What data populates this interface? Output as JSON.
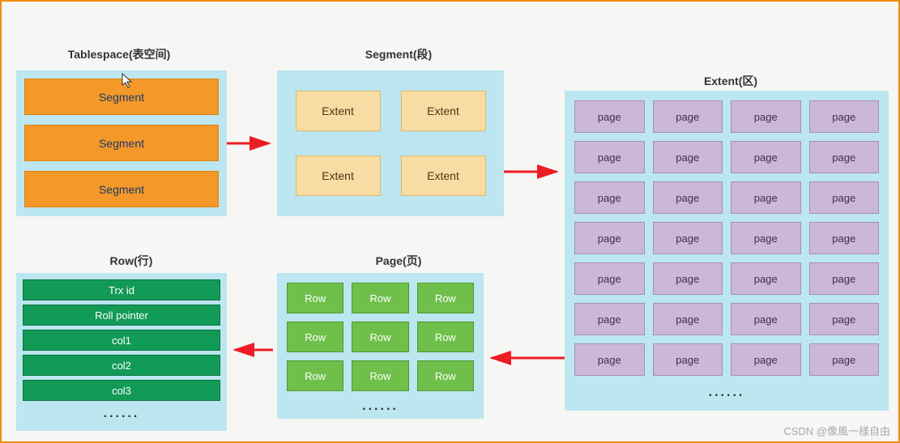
{
  "titles": {
    "tablespace": "Tablespace(表空间)",
    "segment": "Segment(段)",
    "extent": "Extent(区)",
    "page": "Page(页)",
    "row": "Row(行)"
  },
  "tablespace": {
    "items": [
      "Segment",
      "Segment",
      "Segment"
    ]
  },
  "segment": {
    "items": [
      "Extent",
      "Extent",
      "Extent",
      "Extent"
    ]
  },
  "extent": {
    "page_label": "page",
    "rows": 7,
    "cols": 4,
    "ellipsis": "......"
  },
  "page": {
    "row_label": "Row",
    "rows": 3,
    "cols": 3,
    "ellipsis": "......"
  },
  "row": {
    "fields": [
      "Trx id",
      "Roll pointer",
      "col1",
      "col2",
      "col3"
    ],
    "ellipsis": "......"
  },
  "watermark": "CSDN @像風一様自由",
  "colors": {
    "background": "#f6f6f4",
    "panel": "#bce6f0",
    "segment_block": "#f39829",
    "extent_block": "#f9dca4",
    "page_block": "#cbb8d9",
    "row_block": "#6fbf4b",
    "field_block": "#129a57",
    "arrow": "#ee1c25",
    "border_accent": "#f28d0f"
  }
}
